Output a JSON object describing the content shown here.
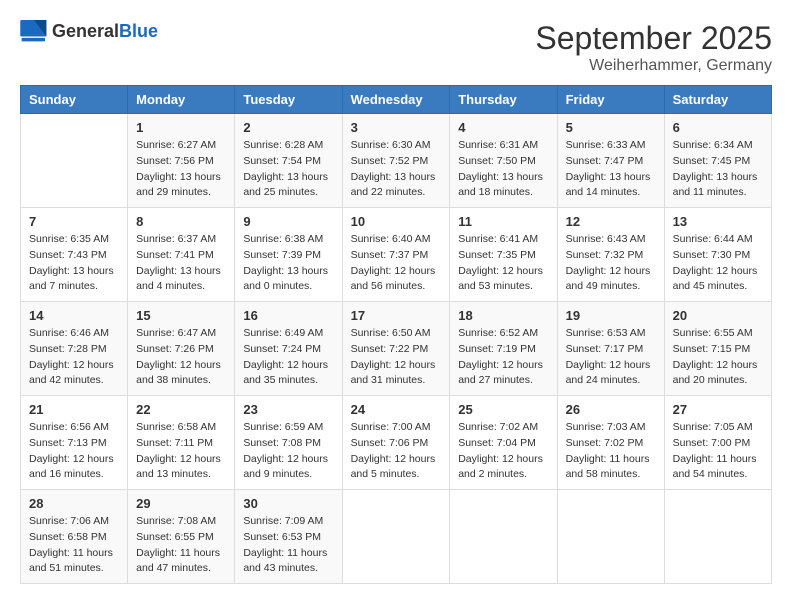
{
  "header": {
    "logo_general": "General",
    "logo_blue": "Blue",
    "month_title": "September 2025",
    "subtitle": "Weiherhammer, Germany"
  },
  "days_of_week": [
    "Sunday",
    "Monday",
    "Tuesday",
    "Wednesday",
    "Thursday",
    "Friday",
    "Saturday"
  ],
  "weeks": [
    [
      {
        "day": "",
        "info": ""
      },
      {
        "day": "1",
        "info": "Sunrise: 6:27 AM\nSunset: 7:56 PM\nDaylight: 13 hours and 29 minutes."
      },
      {
        "day": "2",
        "info": "Sunrise: 6:28 AM\nSunset: 7:54 PM\nDaylight: 13 hours and 25 minutes."
      },
      {
        "day": "3",
        "info": "Sunrise: 6:30 AM\nSunset: 7:52 PM\nDaylight: 13 hours and 22 minutes."
      },
      {
        "day": "4",
        "info": "Sunrise: 6:31 AM\nSunset: 7:50 PM\nDaylight: 13 hours and 18 minutes."
      },
      {
        "day": "5",
        "info": "Sunrise: 6:33 AM\nSunset: 7:47 PM\nDaylight: 13 hours and 14 minutes."
      },
      {
        "day": "6",
        "info": "Sunrise: 6:34 AM\nSunset: 7:45 PM\nDaylight: 13 hours and 11 minutes."
      }
    ],
    [
      {
        "day": "7",
        "info": "Sunrise: 6:35 AM\nSunset: 7:43 PM\nDaylight: 13 hours and 7 minutes."
      },
      {
        "day": "8",
        "info": "Sunrise: 6:37 AM\nSunset: 7:41 PM\nDaylight: 13 hours and 4 minutes."
      },
      {
        "day": "9",
        "info": "Sunrise: 6:38 AM\nSunset: 7:39 PM\nDaylight: 13 hours and 0 minutes."
      },
      {
        "day": "10",
        "info": "Sunrise: 6:40 AM\nSunset: 7:37 PM\nDaylight: 12 hours and 56 minutes."
      },
      {
        "day": "11",
        "info": "Sunrise: 6:41 AM\nSunset: 7:35 PM\nDaylight: 12 hours and 53 minutes."
      },
      {
        "day": "12",
        "info": "Sunrise: 6:43 AM\nSunset: 7:32 PM\nDaylight: 12 hours and 49 minutes."
      },
      {
        "day": "13",
        "info": "Sunrise: 6:44 AM\nSunset: 7:30 PM\nDaylight: 12 hours and 45 minutes."
      }
    ],
    [
      {
        "day": "14",
        "info": "Sunrise: 6:46 AM\nSunset: 7:28 PM\nDaylight: 12 hours and 42 minutes."
      },
      {
        "day": "15",
        "info": "Sunrise: 6:47 AM\nSunset: 7:26 PM\nDaylight: 12 hours and 38 minutes."
      },
      {
        "day": "16",
        "info": "Sunrise: 6:49 AM\nSunset: 7:24 PM\nDaylight: 12 hours and 35 minutes."
      },
      {
        "day": "17",
        "info": "Sunrise: 6:50 AM\nSunset: 7:22 PM\nDaylight: 12 hours and 31 minutes."
      },
      {
        "day": "18",
        "info": "Sunrise: 6:52 AM\nSunset: 7:19 PM\nDaylight: 12 hours and 27 minutes."
      },
      {
        "day": "19",
        "info": "Sunrise: 6:53 AM\nSunset: 7:17 PM\nDaylight: 12 hours and 24 minutes."
      },
      {
        "day": "20",
        "info": "Sunrise: 6:55 AM\nSunset: 7:15 PM\nDaylight: 12 hours and 20 minutes."
      }
    ],
    [
      {
        "day": "21",
        "info": "Sunrise: 6:56 AM\nSunset: 7:13 PM\nDaylight: 12 hours and 16 minutes."
      },
      {
        "day": "22",
        "info": "Sunrise: 6:58 AM\nSunset: 7:11 PM\nDaylight: 12 hours and 13 minutes."
      },
      {
        "day": "23",
        "info": "Sunrise: 6:59 AM\nSunset: 7:08 PM\nDaylight: 12 hours and 9 minutes."
      },
      {
        "day": "24",
        "info": "Sunrise: 7:00 AM\nSunset: 7:06 PM\nDaylight: 12 hours and 5 minutes."
      },
      {
        "day": "25",
        "info": "Sunrise: 7:02 AM\nSunset: 7:04 PM\nDaylight: 12 hours and 2 minutes."
      },
      {
        "day": "26",
        "info": "Sunrise: 7:03 AM\nSunset: 7:02 PM\nDaylight: 11 hours and 58 minutes."
      },
      {
        "day": "27",
        "info": "Sunrise: 7:05 AM\nSunset: 7:00 PM\nDaylight: 11 hours and 54 minutes."
      }
    ],
    [
      {
        "day": "28",
        "info": "Sunrise: 7:06 AM\nSunset: 6:58 PM\nDaylight: 11 hours and 51 minutes."
      },
      {
        "day": "29",
        "info": "Sunrise: 7:08 AM\nSunset: 6:55 PM\nDaylight: 11 hours and 47 minutes."
      },
      {
        "day": "30",
        "info": "Sunrise: 7:09 AM\nSunset: 6:53 PM\nDaylight: 11 hours and 43 minutes."
      },
      {
        "day": "",
        "info": ""
      },
      {
        "day": "",
        "info": ""
      },
      {
        "day": "",
        "info": ""
      },
      {
        "day": "",
        "info": ""
      }
    ]
  ]
}
